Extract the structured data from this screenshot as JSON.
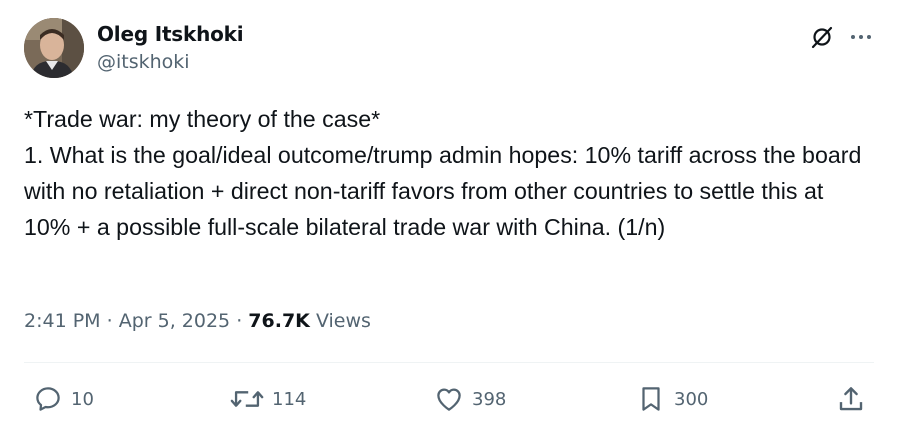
{
  "author": {
    "display_name": "Oleg Itskhoki",
    "handle": "@itskhoki"
  },
  "tweet": {
    "text": "*Trade war: my theory of the case*\n1. What is the goal/ideal outcome/trump admin hopes: 10% tariff across the board with no retaliation + direct non-tariff favors from other countries to settle this at 10% + a possible full-scale bilateral trade war with China. (1/n)",
    "time": "2:41 PM",
    "separator": "·",
    "date": "Apr 5, 2025",
    "views_count": "76.7K",
    "views_label": "Views"
  },
  "actions": {
    "replies": "10",
    "reposts": "114",
    "likes": "398",
    "bookmarks": "300"
  },
  "icons": {
    "grok": "grok-icon",
    "more": "more-icon",
    "reply": "reply-icon",
    "repost": "repost-icon",
    "like": "heart-icon",
    "bookmark": "bookmark-icon",
    "share": "share-icon"
  },
  "colors": {
    "text_primary": "#0f1419",
    "text_secondary": "#536471",
    "divider": "#eff3f4"
  }
}
